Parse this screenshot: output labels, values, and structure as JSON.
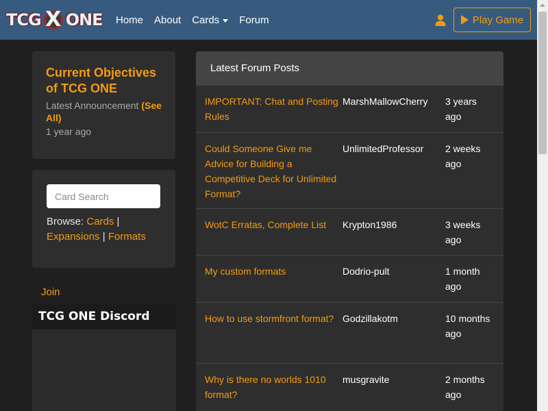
{
  "brand": {
    "logo_left": "TCG",
    "logo_mid": "X",
    "logo_right": "ONE"
  },
  "nav": {
    "items": [
      "Home",
      "About",
      "Cards",
      "Forum"
    ],
    "play_label": "Play Game"
  },
  "objectives": {
    "title": "Current Objectives of TCG ONE",
    "announcement_label": "Latest Announcement",
    "see_all": "(See All)",
    "time": "1 year ago"
  },
  "search": {
    "placeholder": "Card Search",
    "browse_label": "Browse:",
    "links": [
      "Cards",
      "Expansions",
      "Formats"
    ],
    "separator": "|"
  },
  "join": {
    "label": "Join"
  },
  "discord": {
    "title": "TCG ONE Discord"
  },
  "forum": {
    "heading": "Latest Forum Posts",
    "posts": [
      {
        "title": "IMPORTANT: Chat and Posting Rules",
        "user": "MarshMallowCherry",
        "time": "3 years ago"
      },
      {
        "title": "Could Someone Give me Advice for Building a Competitive Deck for Unlimited Format?",
        "user": "UnlimitedProfessor",
        "time": "2 weeks ago"
      },
      {
        "title": "WotC Erratas, Complete List",
        "user": "Krypton1986",
        "time": "3 weeks ago"
      },
      {
        "title": "My custom formats",
        "user": "Dodrio-pult",
        "time": "1 month ago"
      },
      {
        "title": "How to use stormfront format?",
        "user": "Godzillakotm",
        "time": "10 months ago"
      },
      {
        "title": "Why is there no worlds 1010 format?",
        "user": "musgravite",
        "time": "2 months ago"
      }
    ]
  },
  "colors": {
    "navbar": "#375a7f",
    "accent": "#f39c12",
    "background": "#1f1f1f",
    "card": "#2e2e2e"
  },
  "icons": {
    "user": "user-icon",
    "play": "play-icon"
  }
}
